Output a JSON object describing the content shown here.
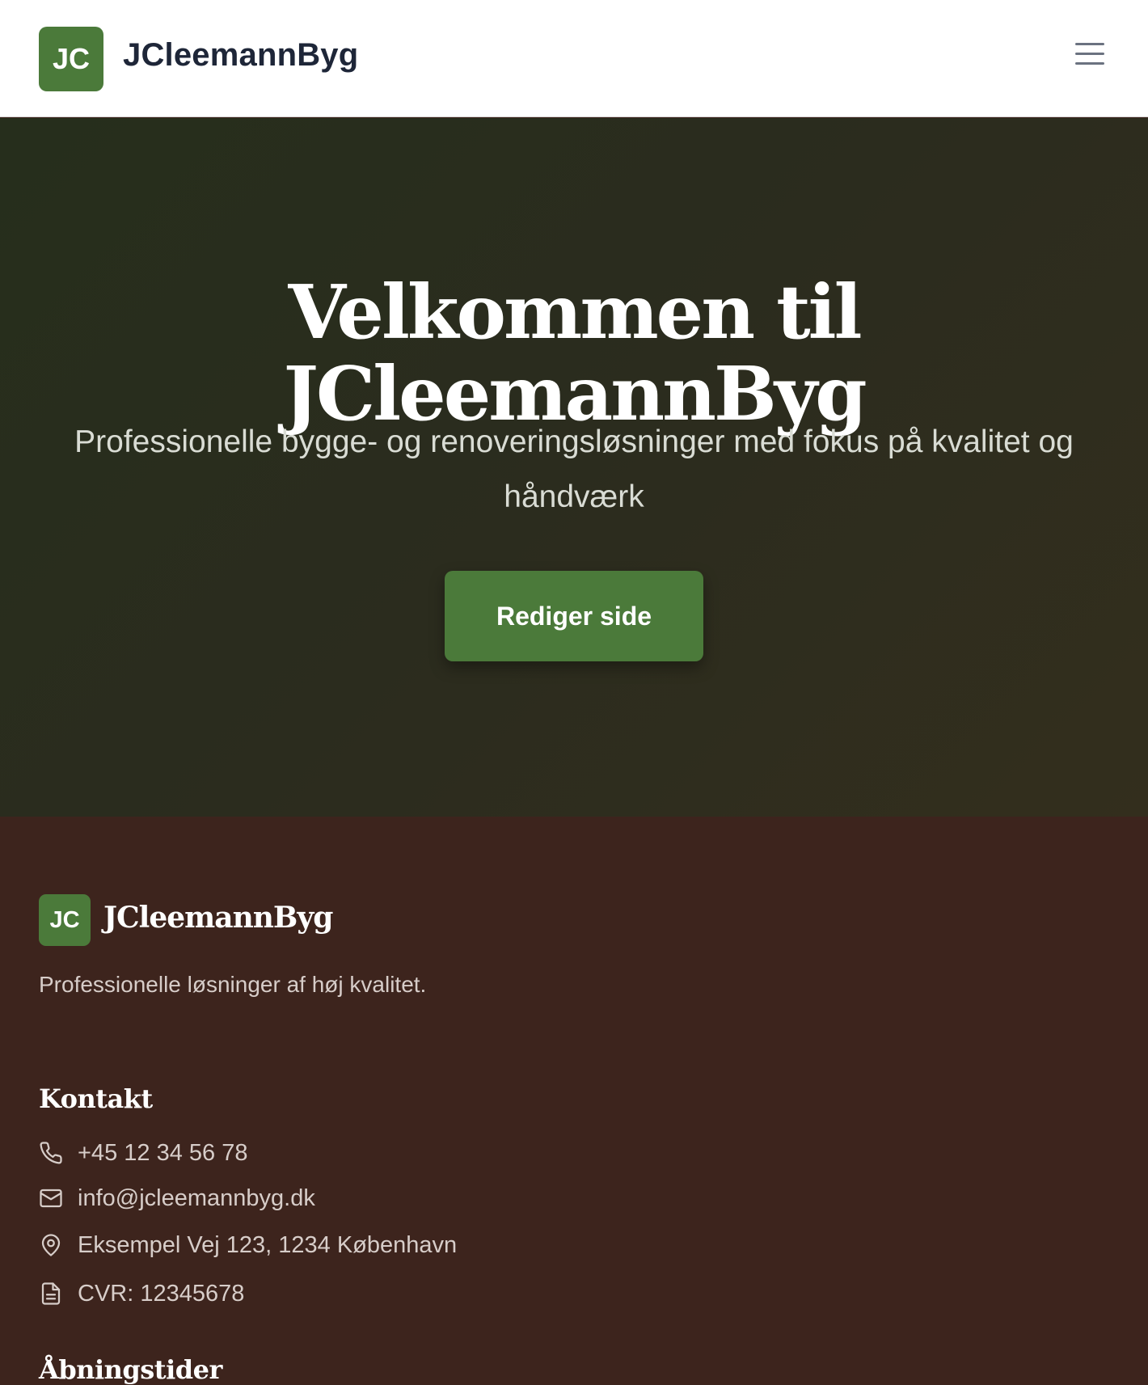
{
  "header": {
    "logo_initials": "JC",
    "brand": "JCleemannByg",
    "menu_icon": "hamburger-menu-icon"
  },
  "hero": {
    "title": "Velkommen til JCleemannByg",
    "subtitle": "Professionelle bygge- og renoveringsløsninger med fokus på kvalitet og håndværk",
    "cta_label": "Rediger side"
  },
  "footer": {
    "logo_initials": "JC",
    "brand": "JCleemannByg",
    "tagline": "Professionelle løsninger af høj kvalitet.",
    "contact_heading": "Kontakt",
    "contact": [
      {
        "icon": "phone-icon",
        "text": "+45 12 34 56 78"
      },
      {
        "icon": "mail-icon",
        "text": "info@jcleemannbyg.dk"
      },
      {
        "icon": "map-pin-icon",
        "text": "Eksempel Vej 123, 1234 København"
      },
      {
        "icon": "document-icon",
        "text": "CVR: 12345678"
      }
    ],
    "hours_heading": "Åbningstider"
  },
  "colors": {
    "accent": "#4b7a3a",
    "header_text": "#1e2638",
    "hero_bg": "#2b2c1e",
    "footer_bg": "#3d241d"
  }
}
